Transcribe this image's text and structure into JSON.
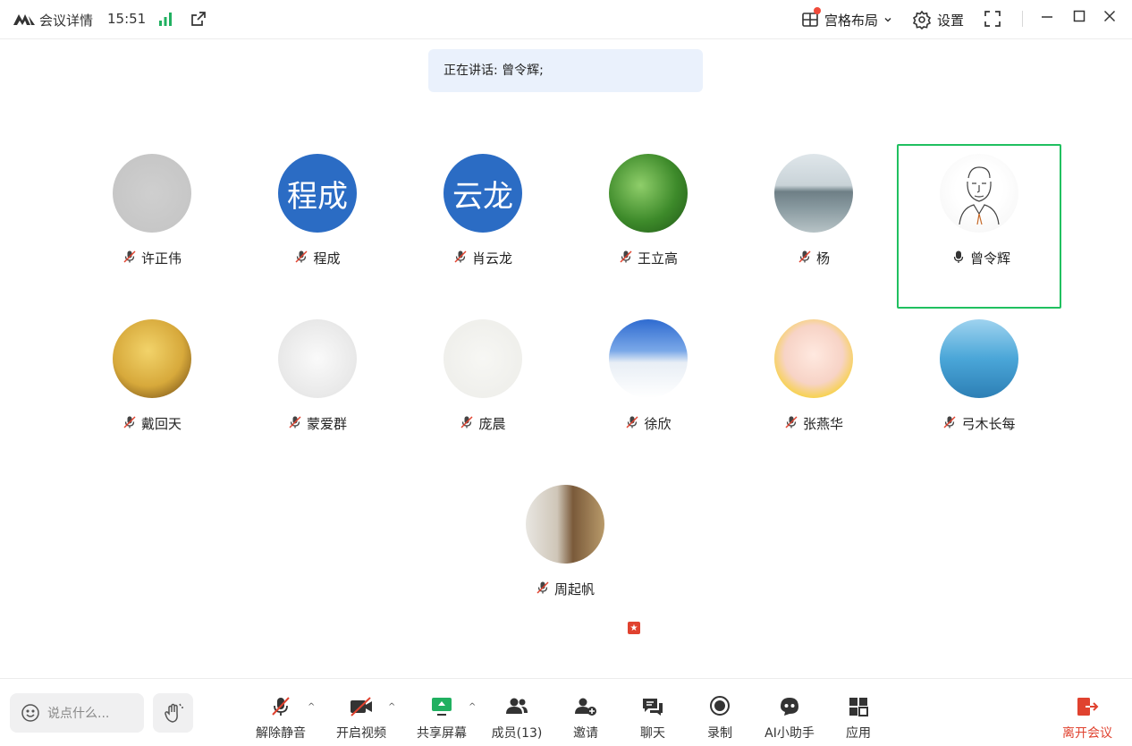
{
  "header": {
    "app_title": "会议详情",
    "time": "15:51",
    "layout_label": "宫格布局",
    "settings_label": "设置"
  },
  "speaking_banner": "正在讲话: 曾令辉;",
  "participants": [
    {
      "name": "许正伟",
      "muted": true,
      "avatar": "photo-gray"
    },
    {
      "name": "程成",
      "muted": true,
      "avatar": "text",
      "avatar_text": "程成"
    },
    {
      "name": "肖云龙",
      "muted": true,
      "avatar": "text",
      "avatar_text": "云龙"
    },
    {
      "name": "王立高",
      "muted": true,
      "avatar": "photo-forest"
    },
    {
      "name": "杨",
      "muted": true,
      "avatar": "photo-lake"
    },
    {
      "name": "曾令辉",
      "muted": false,
      "avatar": "photo-sketch",
      "speaking": true
    },
    {
      "name": "戴回天",
      "muted": true,
      "avatar": "photo-gold"
    },
    {
      "name": "蒙爱群",
      "muted": true,
      "avatar": "photo-drawing"
    },
    {
      "name": "庞晨",
      "muted": true,
      "avatar": "photo-doodle"
    },
    {
      "name": "徐欣",
      "muted": true,
      "avatar": "photo-mountain"
    },
    {
      "name": "张燕华",
      "muted": true,
      "avatar": "photo-baby"
    },
    {
      "name": "弓木长每",
      "muted": true,
      "avatar": "photo-sea"
    },
    {
      "name": "周起帆",
      "muted": true,
      "avatar": "photo-books"
    }
  ],
  "toolbar": {
    "chat_placeholder": "说点什么...",
    "unmute": "解除静音",
    "start_video": "开启视频",
    "share_screen": "共享屏幕",
    "members": "成员(13)",
    "invite": "邀请",
    "chat": "聊天",
    "record": "录制",
    "ai_assistant": "AI小助手",
    "apps": "应用",
    "leave": "离开会议"
  },
  "colors": {
    "accent_green": "#20c060",
    "avatar_blue": "#2b6cc4",
    "leave_red": "#e0422f",
    "banner_bg": "#eaf1fc"
  }
}
